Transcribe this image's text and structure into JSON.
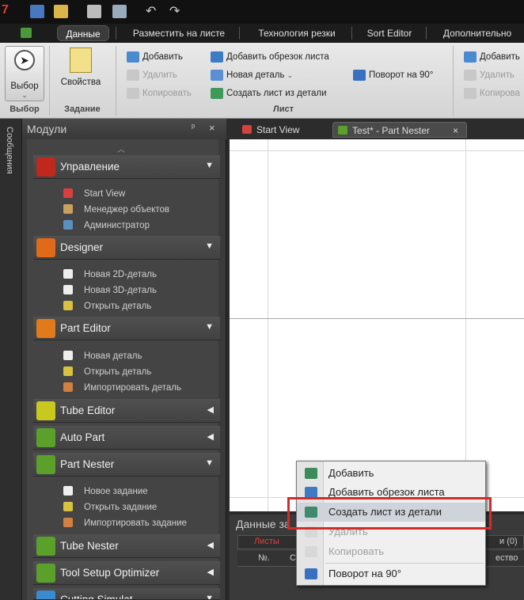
{
  "titlebar": {
    "logo": "7"
  },
  "ribbon_tabs": [
    "Данные",
    "Разместить на листе",
    "Технология резки",
    "Sort Editor",
    "Дополнительно"
  ],
  "ribbon": {
    "select_label": "Выбор",
    "select_group": "Выбор",
    "props_label": "Свойства",
    "task_group": "Задание",
    "sheet_group": "Лист",
    "col1": [
      "Добавить",
      "Удалить",
      "Копировать"
    ],
    "col2": [
      "Добавить обрезок листа",
      "Новая деталь",
      "Создать лист из детали"
    ],
    "col3": [
      "Поворот на 90°"
    ],
    "col4": [
      "Добавить",
      "Удалить",
      "Копирова"
    ]
  },
  "messages_strip": "Сообщения",
  "modules": {
    "title": "Модули",
    "pin": "ᵖ",
    "close": "×",
    "groups": [
      {
        "label": "Управление",
        "arrow": "▼",
        "items": [
          "Start View",
          "Менеджер объектов",
          "Администратор"
        ]
      },
      {
        "label": "Designer",
        "arrow": "▼",
        "items": [
          "Новая 2D-деталь",
          "Новая 3D-деталь",
          "Открыть деталь"
        ]
      },
      {
        "label": "Part Editor",
        "arrow": "▼",
        "items": [
          "Новая деталь",
          "Открыть деталь",
          "Импортировать деталь"
        ]
      },
      {
        "label": "Tube Editor",
        "arrow": "◀",
        "items": []
      },
      {
        "label": "Auto Part",
        "arrow": "◀",
        "items": []
      },
      {
        "label": "Part Nester",
        "arrow": "▼",
        "items": [
          "Новое задание",
          "Открыть задание",
          "Импортировать задание"
        ]
      },
      {
        "label": "Tube Nester",
        "arrow": "◀",
        "items": []
      },
      {
        "label": "Tool Setup Optimizer",
        "arrow": "◀",
        "items": []
      },
      {
        "label": "Cutting Simulat",
        "arrow": "▼",
        "items": []
      }
    ]
  },
  "doc_tabs": [
    {
      "label": "Start View"
    },
    {
      "label": "Test* - Part Nester",
      "close": "×"
    }
  ],
  "data_panel": {
    "title": "Данные за",
    "tab_sheets": "Листы",
    "count": "и (0)",
    "col_no": "№.",
    "col_c": "С",
    "col_qty": "ество"
  },
  "context_menu": {
    "items": [
      {
        "label": "Добавить",
        "enabled": true
      },
      {
        "label": "Добавить обрезок листа",
        "enabled": true
      },
      {
        "label": "Создать лист из детали",
        "enabled": true,
        "highlighted": true
      },
      {
        "label": "Удалить",
        "enabled": false
      },
      {
        "label": "Копировать",
        "enabled": false
      },
      {
        "label": "Поворот на 90°",
        "enabled": true
      }
    ]
  },
  "colors": {
    "highlight_border": "#d42a2a",
    "accent_red": "#e83a3a"
  }
}
